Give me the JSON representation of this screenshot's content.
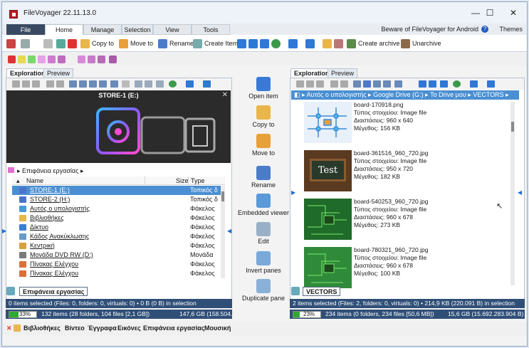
{
  "app": {
    "title": "FileVoyager 22.11.13.0"
  },
  "window_controls": {
    "minimize": "—",
    "maximize": "☐",
    "close": "✕"
  },
  "ribbon_tabs": [
    {
      "label": "File"
    },
    {
      "label": "Home"
    },
    {
      "label": "Manage"
    },
    {
      "label": "Selection"
    },
    {
      "label": "View"
    },
    {
      "label": "Tools"
    }
  ],
  "ribbon_right": {
    "beware": "Beware of FileVoyager for Android",
    "help": "?",
    "themes": "Themes"
  },
  "ribbon": {
    "copy_to": "Copy to",
    "move_to": "Move to",
    "rename": "Rename",
    "create_item": "Create Item",
    "create_archive": "Create archive",
    "unarchive": "Unarchive"
  },
  "left": {
    "tabs": [
      "Exploration",
      "Preview"
    ],
    "preview_title": "STORE-1 (E:)",
    "breadcrumb": "Επιφάνεια εργασίας",
    "columns": {
      "name": "Name",
      "size": "Size",
      "type": "Type"
    },
    "rows": [
      {
        "name": "STORE-1 (E:)",
        "type": "Τοπικός δ",
        "color": "#4a74c9",
        "selected": true
      },
      {
        "name": "STORE-2 (H:)",
        "type": "Τοπικός δ",
        "color": "#4a74c9",
        "selected": false
      },
      {
        "name": "Αυτός ο υπολογιστής",
        "type": "Φάκελος",
        "color": "#4a9ad8",
        "selected": false
      },
      {
        "name": "Βιβλιοθήκες",
        "type": "Φάκελος",
        "color": "#e7b84a",
        "selected": false
      },
      {
        "name": "Δίκτυο",
        "type": "Φάκελος",
        "color": "#3b7dd8",
        "selected": false
      },
      {
        "name": "Κάδος Ανακύκλωσης",
        "type": "Φάκελος",
        "color": "#6a9ac6",
        "selected": false
      },
      {
        "name": "Κεντρική",
        "type": "Φάκελος",
        "color": "#d6a040",
        "selected": false
      },
      {
        "name": "Μονάδα DVD RW (D:)",
        "type": "Μονάδα",
        "color": "#7a7a7a",
        "selected": false
      },
      {
        "name": "Πίνακας Ελέγχου",
        "type": "Φάκελος",
        "color": "#d9703a",
        "selected": false
      },
      {
        "name": "Πίνακας Ελέγχου",
        "type": "Φάκελος",
        "color": "#d9703a",
        "selected": false
      }
    ],
    "bottom_tab": "Επιφάνεια εργασίας",
    "status1": "0 items selected (Files: 0, folders: 0, virtuals: 0) • 0 B (0 B) in selection",
    "status2_pct": "33%",
    "status2": "132 items (28 folders, 104 files [2,1 GB])",
    "status2b": "147,6 GB (158.504.501.248"
  },
  "middle": {
    "buttons": [
      {
        "label": "Open item"
      },
      {
        "label": "Copy to"
      },
      {
        "label": "Move to"
      },
      {
        "label": "Rename"
      },
      {
        "label": "Embedded viewer"
      },
      {
        "label": "Edit"
      },
      {
        "label": "Invert panes"
      },
      {
        "label": "Duplicate pane"
      }
    ]
  },
  "right": {
    "tabs": [
      "Exploration",
      "Preview"
    ],
    "breadcrumb": [
      "Αυτός ο υπολογιστής",
      "Google Drive (G:)",
      "Το Drive μου",
      "VECTORS"
    ],
    "items": [
      {
        "name": "board-170918.png",
        "type": "Τύπος στοιχείου: Image file",
        "dims": "Διαστάσεις: 960 x 640",
        "size": "Μέγεθος: 156 KB",
        "thumb": "#e8f0fa"
      },
      {
        "name": "board-361516_960_720.jpg",
        "type": "Τύπος στοιχείου: Image file",
        "dims": "Διαστάσεις: 950 x 720",
        "size": "Μέγεθος: 182 KB",
        "thumb": "#5a3a20"
      },
      {
        "name": "board-540253_960_720.jpg",
        "type": "Τύπος στοιχείου: Image file",
        "dims": "Διαστάσεις: 960 x 678",
        "size": "Μέγεθος: 273 KB",
        "thumb": "#1f6b2a"
      },
      {
        "name": "board-780321_960_720.jpg",
        "type": "Τύπος στοιχείου: Image file",
        "dims": "Διαστάσεις: 960 x 678",
        "size": "Μέγεθος: 100 KB",
        "thumb": "#2f8a3a"
      }
    ],
    "bottom_tab": "VECTORS",
    "status1": "2 items selected (Files: 2, folders: 0, virtuals: 0) • 214,9 KB (220.091 B) in selection",
    "status2_pct": "23%",
    "status2": "234 items (0 folders, 234 files [50,6 MB])",
    "status2b": "15,6 GB (15.692.283.904 B) fr"
  },
  "favorites": [
    "Βιβλιοθήκες",
    "Βίντεο",
    "Έγγραφα",
    "Εικόνες",
    "Επιφάνεια εργασίας",
    "Μουσική"
  ],
  "colors": {
    "accent": "#2f4f77",
    "selection": "#4a8fd2",
    "file_tab": "#3b4a63"
  }
}
